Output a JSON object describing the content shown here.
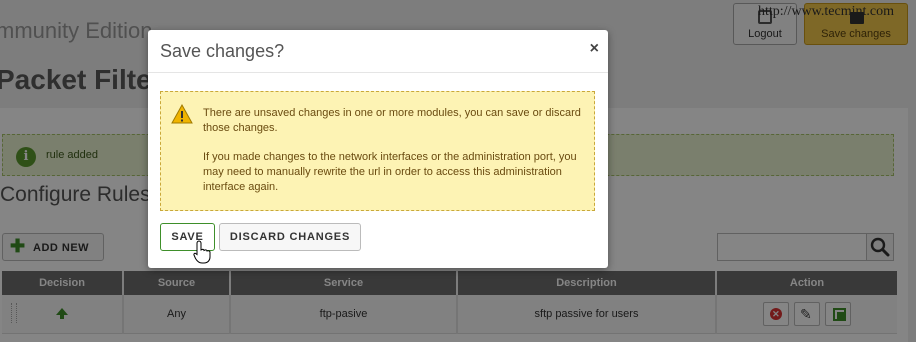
{
  "app": {
    "edition_title": "mmunity Edition",
    "module_title": "Packet Filter",
    "watermark": "http://www.tecmint.com"
  },
  "header_buttons": {
    "logout_label": "Logout",
    "save_changes_label": "Save changes"
  },
  "notice": {
    "text": "rule added"
  },
  "section": {
    "title": "Configure Rules"
  },
  "toolbar": {
    "add_new_label": "ADD NEW",
    "search_placeholder": ""
  },
  "table": {
    "columns": [
      "Decision",
      "Source",
      "Service",
      "Description",
      "Action"
    ],
    "rows": [
      {
        "decision": "accept",
        "source": "Any",
        "service": "ftp-pasive",
        "description": "sftp passive for users"
      }
    ]
  },
  "modal": {
    "title": "Save changes?",
    "close_glyph": "×",
    "message_p1": "There are unsaved changes in one or more modules, you can save or discard those changes.",
    "message_p2": "If you made changes to the network interfaces or the administration port, you may need to manually rewrite the url in order to access this administration interface again.",
    "save_label": "SAVE",
    "discard_label": "DISCARD CHANGES"
  },
  "colors": {
    "accent_green": "#3e8f2a",
    "warning_bg": "#fdf3b4",
    "save_changes_yellow": "#f2c84b",
    "overlay": "rgba(0,0,0,0.48)"
  }
}
